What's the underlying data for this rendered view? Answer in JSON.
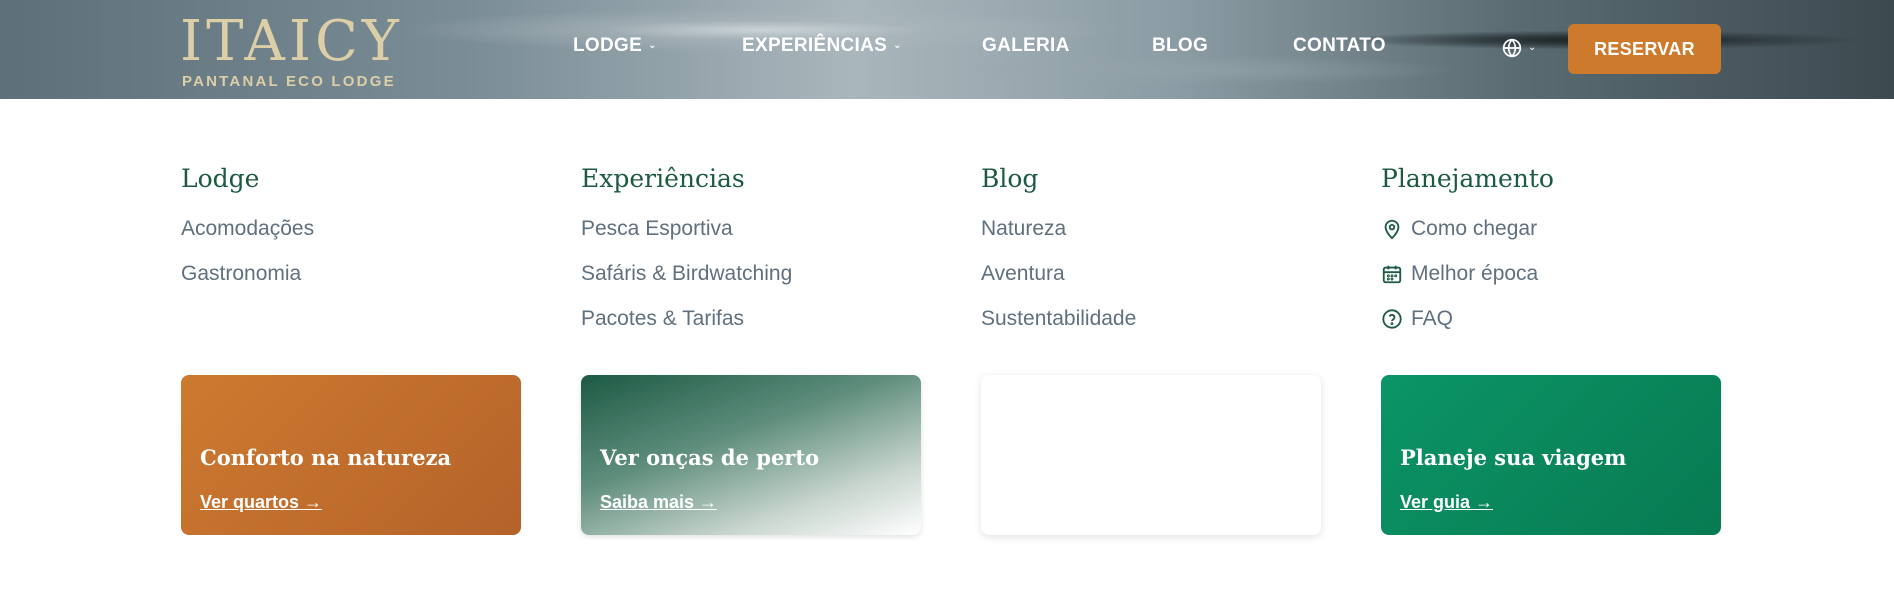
{
  "header": {
    "logo_main": "ITAICY",
    "logo_sub": "PANTANAL ECO LODGE",
    "nav": [
      {
        "label": "LODGE",
        "has_dropdown": true
      },
      {
        "label": "EXPERIÊNCIAS",
        "has_dropdown": true
      },
      {
        "label": "GALERIA",
        "has_dropdown": false
      },
      {
        "label": "BLOG",
        "has_dropdown": false
      },
      {
        "label": "CONTATO",
        "has_dropdown": false
      }
    ],
    "language_icon": "globe-icon",
    "reserve_label": "RESERVAR",
    "accent_color": "#cd7a2c"
  },
  "mega_menu": {
    "columns": [
      {
        "title": "Lodge",
        "links": [
          "Acomodações",
          "Gastronomia"
        ]
      },
      {
        "title": "Experiências",
        "links": [
          "Pesca Esportiva",
          "Safáris & Birdwatching",
          "Pacotes & Tarifas"
        ]
      },
      {
        "title": "Blog",
        "links": [
          "Natureza",
          "Aventura",
          "Sustentabilidade"
        ]
      },
      {
        "title": "Planejamento",
        "links": [
          {
            "icon": "map-pin-icon",
            "label": "Como chegar"
          },
          {
            "icon": "calendar-icon",
            "label": "Melhor época"
          },
          {
            "icon": "help-circle-icon",
            "label": "FAQ"
          }
        ]
      }
    ],
    "cards": [
      {
        "title": "Conforto na natureza",
        "link": "Ver quartos →",
        "color": "#cd7a30"
      },
      {
        "title": "Ver onças de perto",
        "link": "Saiba mais →",
        "color": "#1c5a44"
      },
      {
        "title": "",
        "link": "",
        "color": "#ffffff"
      },
      {
        "title": "Planeje sua viagem",
        "link": "Ver guia →",
        "color": "#0b9566"
      }
    ]
  }
}
